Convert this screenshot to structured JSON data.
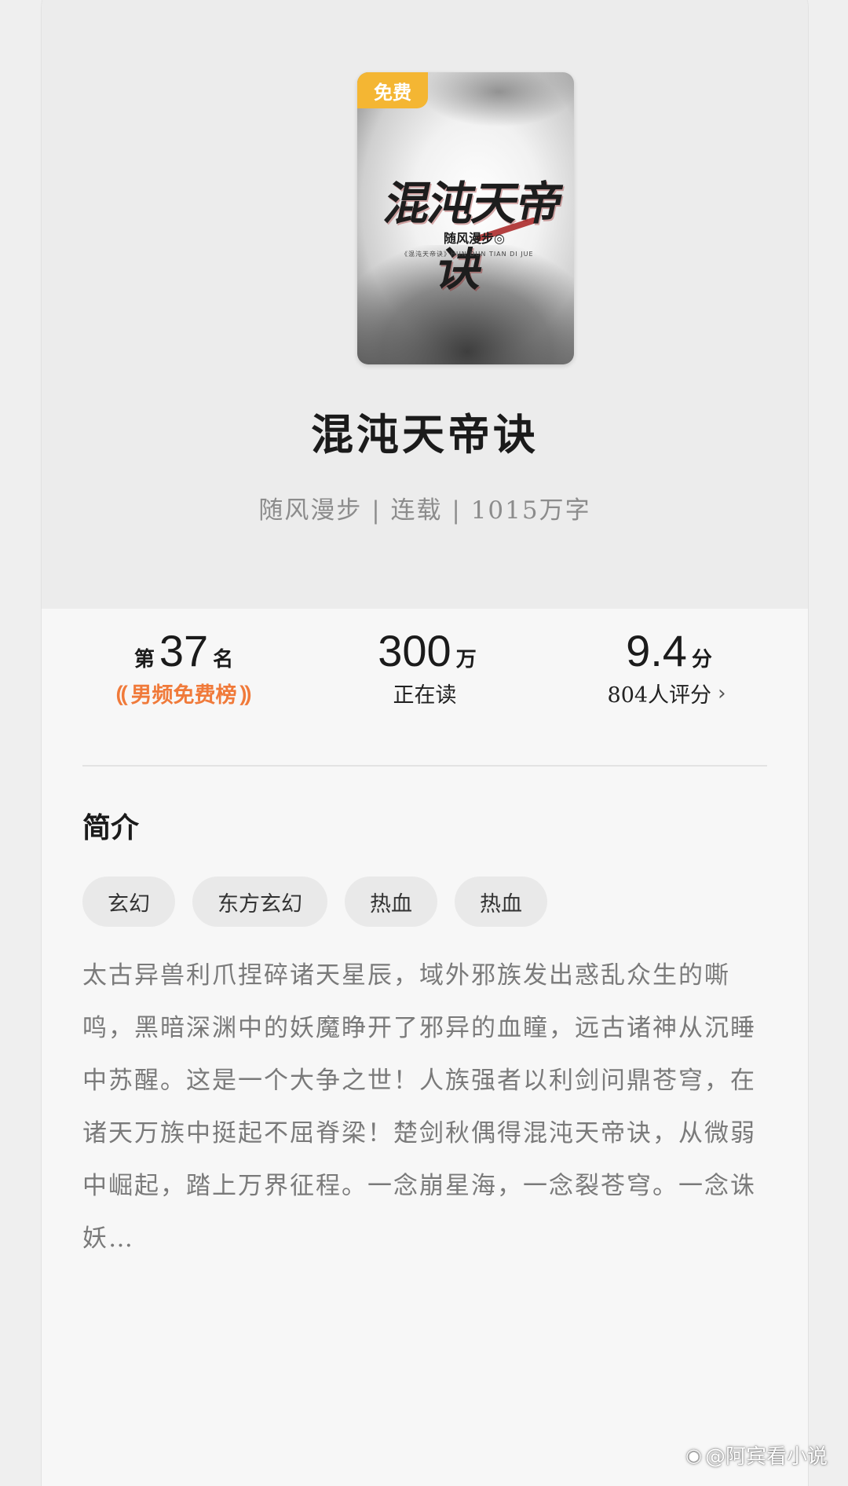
{
  "cover": {
    "badge": "免费",
    "title_art": "混沌天帝诀",
    "author_art": "随风漫步◎",
    "subtitle_art": "《混沌天帝诀》HUN DUN TIAN DI JUE"
  },
  "book": {
    "title": "混沌天帝诀",
    "meta": "随风漫步 | 连载 | 1015万字"
  },
  "stats": {
    "rank": {
      "prefix": "第",
      "value": "37",
      "suffix": "名",
      "label": "男频免费榜",
      "laurel_left": "⸨",
      "laurel_right": "⸩"
    },
    "reading": {
      "value": "300",
      "unit": "万",
      "label": "正在读"
    },
    "score": {
      "value": "9.4",
      "unit": "分",
      "label": "804人评分",
      "chevron": "›"
    }
  },
  "intro": {
    "heading": "简介",
    "tags": [
      "玄幻",
      "东方玄幻",
      "热血",
      "热血"
    ],
    "summary": "太古异兽利爪捏碎诸天星辰，域外邪族发出惑乱众生的嘶鸣，黑暗深渊中的妖魔睁开了邪异的血瞳，远古诸神从沉睡中苏醒。这是一个大争之世！人族强者以利剑问鼎苍穹，在诸天万族中挺起不屈脊梁！楚剑秋偶得混沌天帝诀，从微弱中崛起，踏上万界征程。一念崩星海，一念裂苍穹。一念诛妖…"
  },
  "watermark": {
    "icon": "weibo-icon",
    "text": "@阿宾看小说"
  },
  "colors": {
    "badge": "#f4b633",
    "rank_accent": "#f07a3a",
    "tag_bg": "#e9e9e9"
  }
}
